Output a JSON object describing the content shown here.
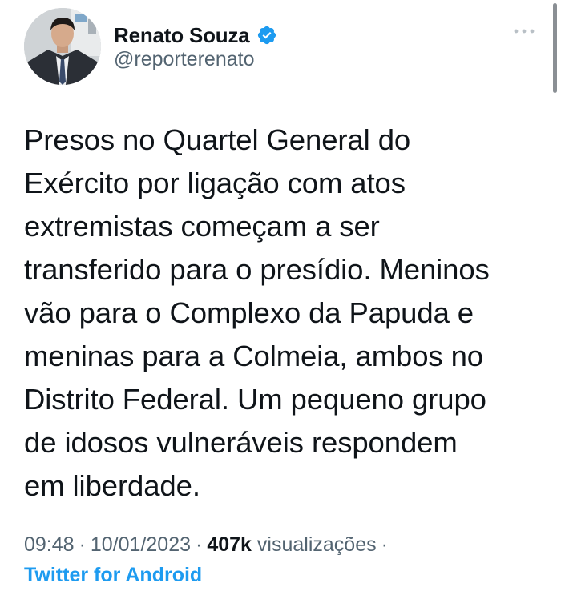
{
  "author": {
    "display_name": "Renato Souza",
    "handle": "@reporterenato",
    "verified": true,
    "verified_color": "#1d9bf0"
  },
  "tweet": {
    "text": "Presos no Quartel General do\nExército por ligação com atos\nextremistas começam a ser\ntransferido para o presídio. Meninos\nvão para o Complexo da Papuda e\nmeninas para a Colmeia, ambos no\nDistrito Federal. Um pequeno grupo\nde idosos vulneráveis respondem\nem liberdade."
  },
  "meta": {
    "time": "09:48",
    "separator": "·",
    "date": "10/01/2023",
    "views_count": "407k",
    "views_label": "visualizações",
    "source": "Twitter for Android"
  },
  "icons": {
    "more": "more-horizontal-icon",
    "verified": "verified-badge-icon",
    "avatar": "profile-avatar"
  },
  "colors": {
    "text_primary": "#0f1419",
    "text_secondary": "#536471",
    "link": "#1d9bf0",
    "background": "#ffffff"
  }
}
